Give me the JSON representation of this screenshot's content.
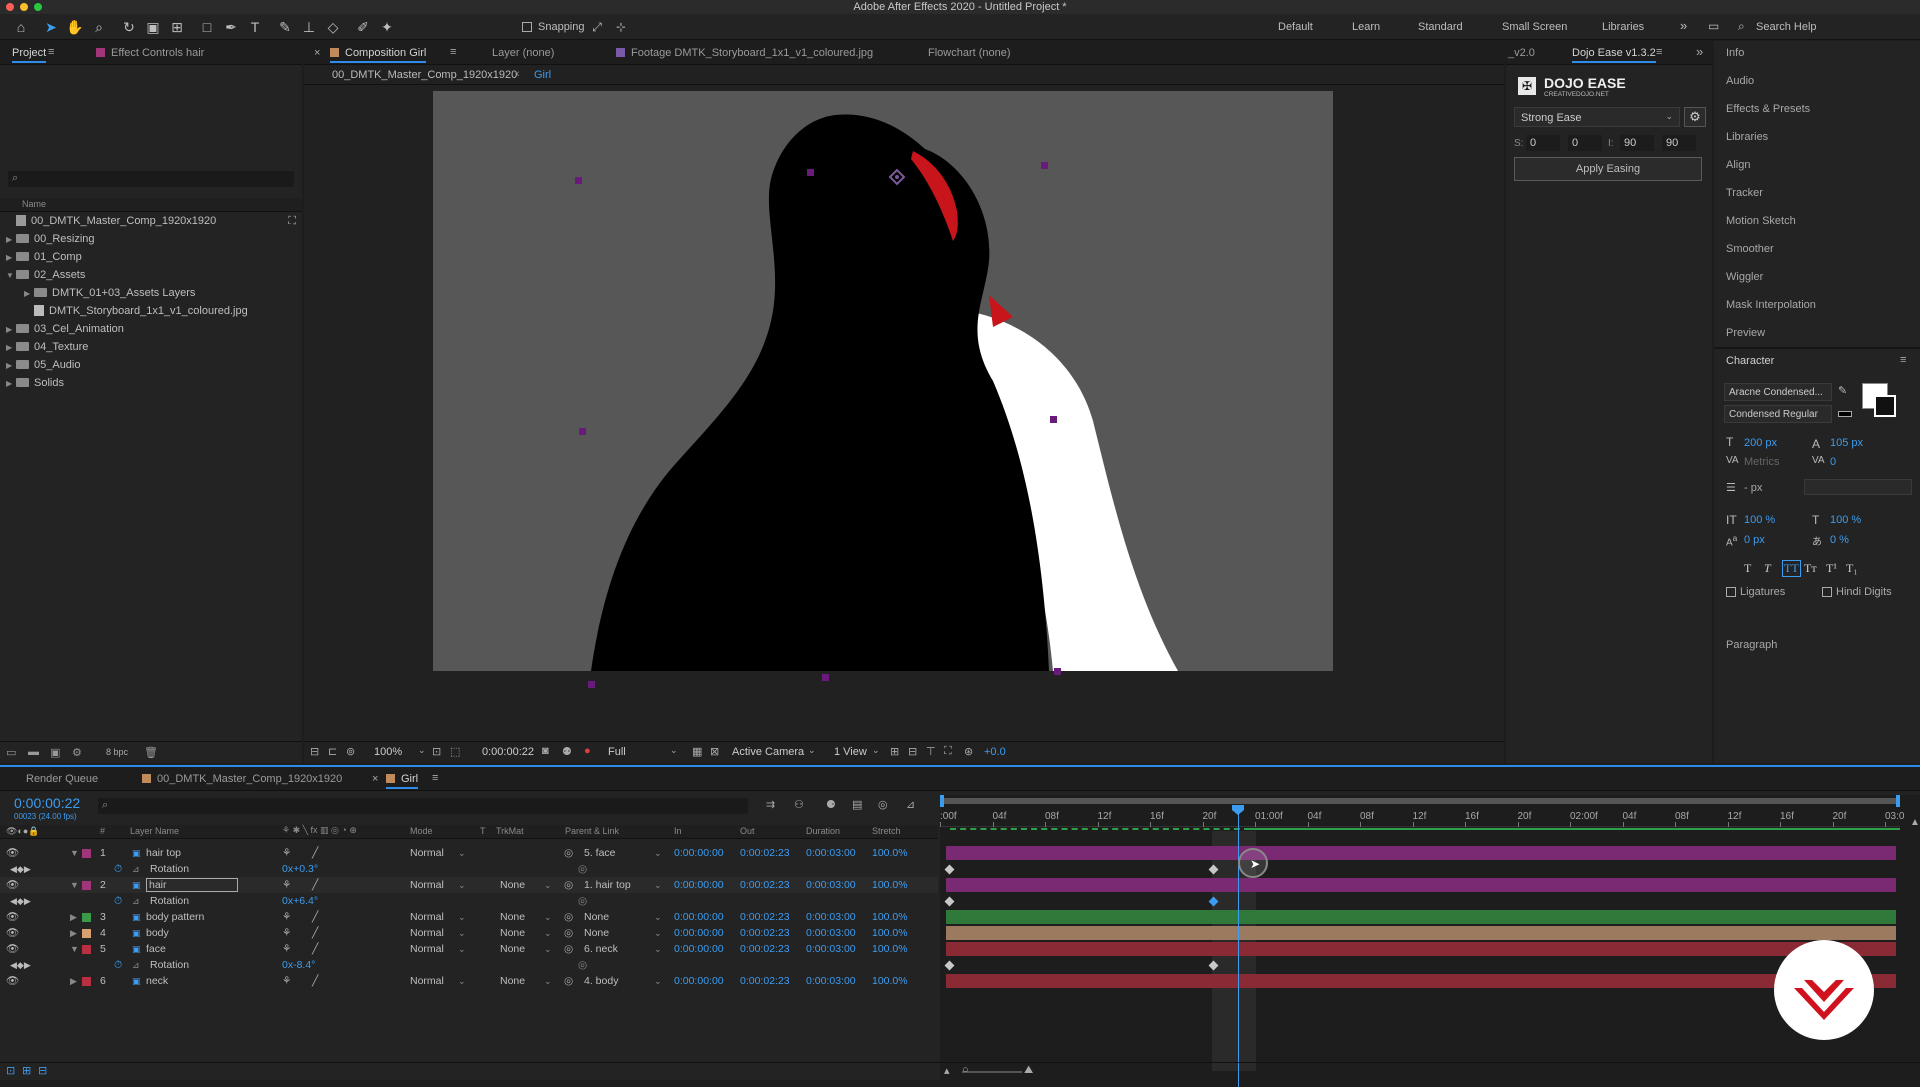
{
  "app": {
    "window_title": "Adobe After Effects 2020 - Untitled Project *"
  },
  "toolbar": {
    "snapping_label": "Snapping",
    "workspaces": [
      "Default",
      "Learn",
      "Standard",
      "Small Screen",
      "Libraries"
    ],
    "search_placeholder": "Search Help"
  },
  "project_panel": {
    "tabs": [
      "Project",
      "Effect Controls hair"
    ],
    "name_header": "Name",
    "items": [
      {
        "label": "00_DMTK_Master_Comp_1920x1920",
        "type": "comp",
        "indent": 0
      },
      {
        "label": "00_Resizing",
        "type": "folder",
        "indent": 0
      },
      {
        "label": "01_Comp",
        "type": "folder",
        "indent": 0
      },
      {
        "label": "02_Assets",
        "type": "folder",
        "indent": 0,
        "open": true
      },
      {
        "label": "DMTK_01+03_Assets Layers",
        "type": "folder",
        "indent": 1
      },
      {
        "label": "DMTK_Storyboard_1x1_v1_coloured.jpg",
        "type": "file",
        "indent": 1
      },
      {
        "label": "03_Cel_Animation",
        "type": "folder",
        "indent": 0
      },
      {
        "label": "04_Texture",
        "type": "folder",
        "indent": 0
      },
      {
        "label": "05_Audio",
        "type": "folder",
        "indent": 0
      },
      {
        "label": "Solids",
        "type": "folder",
        "indent": 0
      }
    ],
    "bpc": "8 bpc"
  },
  "viewer": {
    "tabs": [
      "Composition Girl",
      "Layer (none)",
      "Footage DMTK_Storyboard_1x1_v1_coloured.jpg",
      "Flowchart (none)"
    ],
    "breadcrumb_parent": "00_DMTK_Master_Comp_1920x1920",
    "breadcrumb_current": "Girl",
    "zoom": "100%",
    "timecode": "0:00:00:22",
    "resolution": "Full",
    "camera": "Active Camera",
    "views": "1 View",
    "exposure": "+0.0"
  },
  "dojo_ease": {
    "tabs": [
      "_v2.0",
      "Dojo Ease v1.3.2"
    ],
    "title": "DOJO EASE",
    "subtitle": "CREATIVEDOJO.NET",
    "preset": "Strong Ease",
    "s_label": "S:",
    "values": [
      "0",
      "0",
      "90",
      "90"
    ],
    "i_label": "I:",
    "apply_label": "Apply Easing"
  },
  "right_panels": [
    "Info",
    "Audio",
    "Effects & Presets",
    "Libraries",
    "Align",
    "Tracker",
    "Motion Sketch",
    "Smoother",
    "Wiggler",
    "Mask Interpolation",
    "Preview"
  ],
  "character": {
    "title": "Character",
    "font": "Aracne Condensed...",
    "style": "Condensed Regular",
    "size": "200 px",
    "leading": "105 px",
    "kerning": "Metrics",
    "tracking": "0",
    "stroke": "- px",
    "vscale": "100 %",
    "hscale": "100 %",
    "baseline": "0 px",
    "tsume": "0 %",
    "ligatures": "Ligatures",
    "hindi": "Hindi Digits",
    "paragraph": "Paragraph"
  },
  "timeline": {
    "tabs": [
      "Render Queue",
      "00_DMTK_Master_Comp_1920x1920",
      "Girl"
    ],
    "current_time": "0:00:00:22",
    "frame_info": "00023 (24.00 fps)",
    "columns": [
      "#",
      "Layer Name",
      "Mode",
      "T",
      "TrkMat",
      "Parent & Link",
      "In",
      "Out",
      "Duration",
      "Stretch"
    ],
    "ruler": [
      ":00f",
      "04f",
      "08f",
      "12f",
      "16f",
      "20f",
      "01:00f",
      "04f",
      "08f",
      "12f",
      "16f",
      "20f",
      "02:00f",
      "04f",
      "08f",
      "12f",
      "16f",
      "20f",
      "03:0"
    ],
    "layers": [
      {
        "num": "1",
        "name": "hair top",
        "color": "#a1357a",
        "mode": "Normal",
        "trkmat": "",
        "parent": "5. face",
        "in": "0:00:00:00",
        "out": "0:00:02:23",
        "dur": "0:00:03:00",
        "stretch": "100.0%",
        "prop": "Rotation",
        "prop_val": "0x+0.3°"
      },
      {
        "num": "2",
        "name": "hair",
        "color": "#a1357a",
        "mode": "Normal",
        "trkmat": "None",
        "parent": "1. hair top",
        "in": "0:00:00:00",
        "out": "0:00:02:23",
        "dur": "0:00:03:00",
        "stretch": "100.0%",
        "prop": "Rotation",
        "prop_val": "0x+6.4°"
      },
      {
        "num": "3",
        "name": "body pattern",
        "color": "#3a9a4a",
        "mode": "Normal",
        "trkmat": "None",
        "parent": "None",
        "in": "0:00:00:00",
        "out": "0:00:02:23",
        "dur": "0:00:03:00",
        "stretch": "100.0%"
      },
      {
        "num": "4",
        "name": "body",
        "color": "#d8a070",
        "mode": "Normal",
        "trkmat": "None",
        "parent": "None",
        "in": "0:00:00:00",
        "out": "0:00:02:23",
        "dur": "0:00:03:00",
        "stretch": "100.0%"
      },
      {
        "num": "5",
        "name": "face",
        "color": "#b83040",
        "mode": "Normal",
        "trkmat": "None",
        "parent": "6. neck",
        "in": "0:00:00:00",
        "out": "0:00:02:23",
        "dur": "0:00:03:00",
        "stretch": "100.0%",
        "prop": "Rotation",
        "prop_val": "0x-8.4°"
      },
      {
        "num": "6",
        "name": "neck",
        "color": "#b83040",
        "mode": "Normal",
        "trkmat": "None",
        "parent": "4. body",
        "in": "0:00:00:00",
        "out": "0:00:02:23",
        "dur": "0:00:03:00",
        "stretch": "100.0%"
      }
    ]
  },
  "colors": {
    "accent": "#2d8ceb",
    "purple_bar": "#7a2a72",
    "green_bar": "#2f7a3a",
    "tan_bar": "#9c7a60",
    "red_bar": "#8a2a35"
  }
}
